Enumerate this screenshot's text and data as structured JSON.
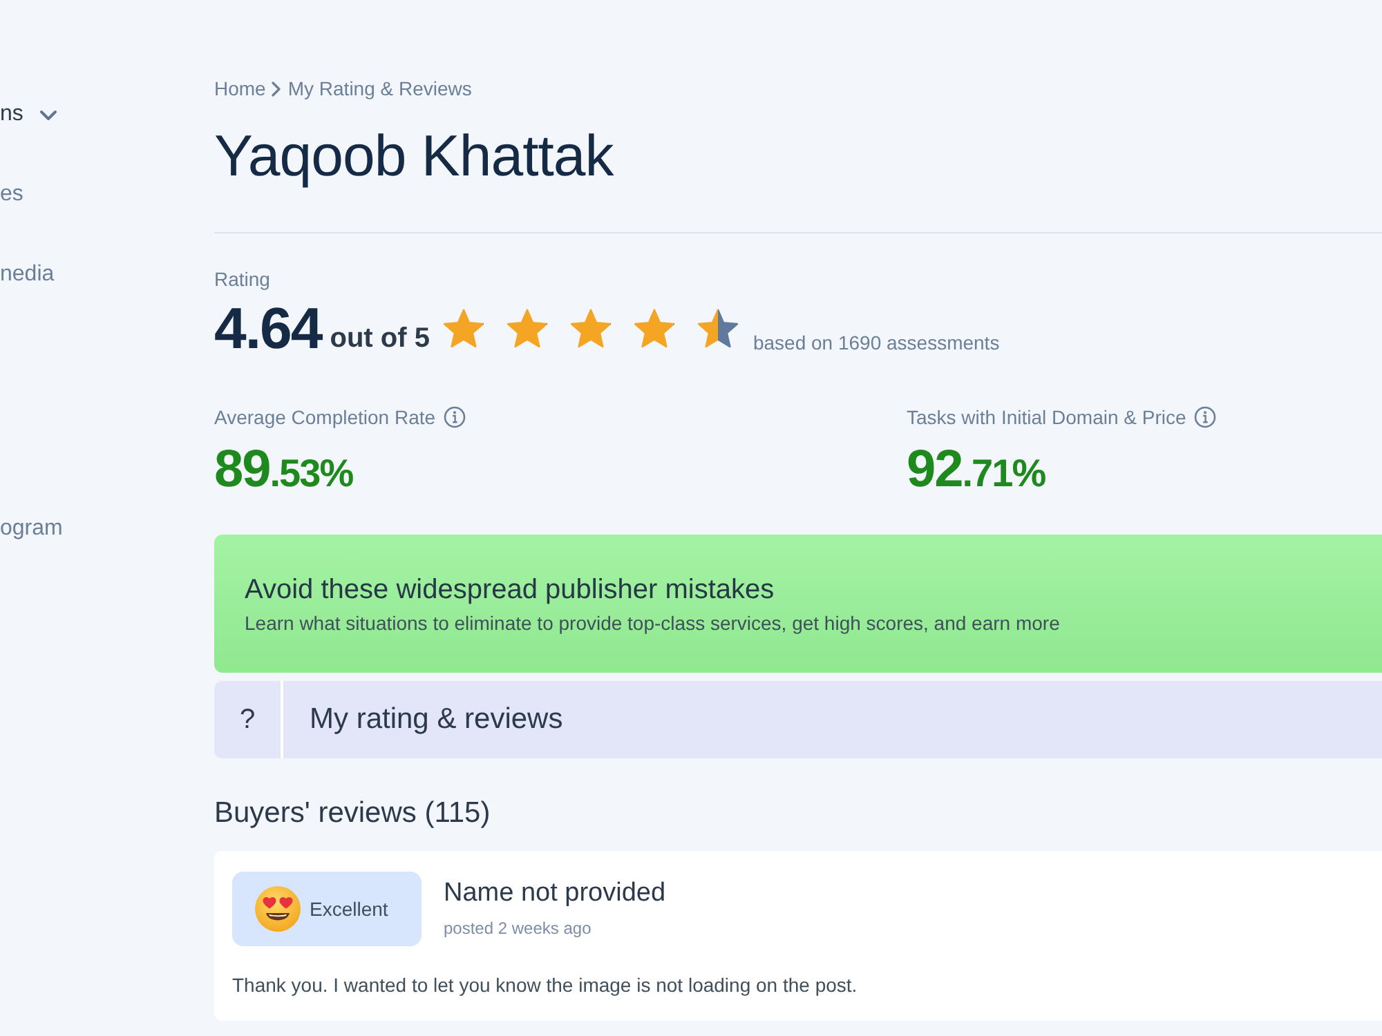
{
  "sidebar": {
    "items": [
      {
        "label": "ns",
        "kind": "dropdown"
      },
      {
        "label": "es",
        "kind": "link"
      },
      {
        "label": "nedia",
        "kind": "link"
      },
      {
        "label": "ogram",
        "kind": "link"
      }
    ]
  },
  "breadcrumb": [
    {
      "label": "Home"
    },
    {
      "label": "My Rating & Reviews"
    }
  ],
  "title": "Yaqoob Khattak",
  "rating": {
    "label": "Rating",
    "score": "4.64",
    "scale": "out of 5",
    "stars": 4.5,
    "basis": "based on 1690 assessments"
  },
  "metrics": [
    {
      "label": "Average Completion Rate",
      "value_whole": "89",
      "value_fraction": ".53%"
    },
    {
      "label": "Tasks with Initial Domain & Price",
      "value_whole": "92",
      "value_fraction": ".71%"
    }
  ],
  "banner": {
    "title": "Avoid these widespread publisher mistakes",
    "subtitle": "Learn what situations to eliminate to provide top-class services, get high scores, and earn more"
  },
  "help_bar": {
    "icon_text": "?",
    "label": "My rating & reviews"
  },
  "reviews": {
    "heading": "Buyers' reviews (115)",
    "items": [
      {
        "badge": "Excellent",
        "name": "Name not provided",
        "posted": "posted 2 weeks ago",
        "text": "Thank you. I wanted to let you know the image is not loading on the post."
      }
    ]
  }
}
